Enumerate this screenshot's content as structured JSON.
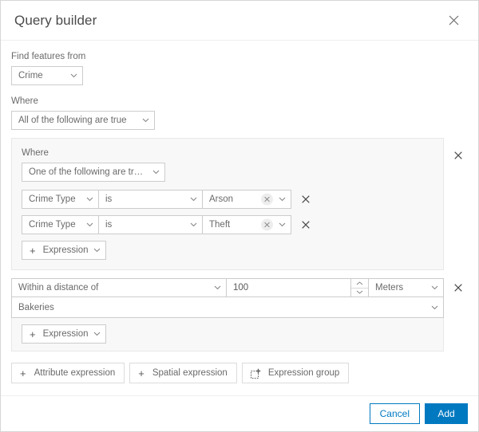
{
  "dialog": {
    "title": "Query builder",
    "close_icon": "close-icon"
  },
  "source": {
    "label": "Find features from",
    "value": "Crime"
  },
  "where": {
    "label": "Where",
    "value": "All of the following are true"
  },
  "group": {
    "label": "Where",
    "value": "One of the following are tr…",
    "remove_icon": "close-icon",
    "expressions": [
      {
        "field": "Crime Type",
        "operator": "is",
        "value": "Arson",
        "clear_icon": "close-icon",
        "remove_icon": "close-icon"
      },
      {
        "field": "Crime Type",
        "operator": "is",
        "value": "Theft",
        "clear_icon": "close-icon",
        "remove_icon": "close-icon"
      }
    ],
    "add_expression": {
      "plus": "+",
      "label": "Expression"
    }
  },
  "spatial": {
    "relationship": "Within a distance of",
    "distance": "100",
    "unit": "Meters",
    "target": "Bakeries",
    "remove_icon": "close-icon",
    "spinner_up_icon": "chevron-up-icon",
    "spinner_down_icon": "chevron-down-icon",
    "add_expression": {
      "plus": "+",
      "label": "Expression"
    }
  },
  "toolbar": {
    "attribute_expression": {
      "plus": "+",
      "label": "Attribute expression"
    },
    "spatial_expression": {
      "plus": "+",
      "label": "Spatial expression"
    },
    "expression_group": {
      "icon": "expression-group-icon",
      "label": "Expression group"
    }
  },
  "footer": {
    "cancel_label": "Cancel",
    "add_label": "Add"
  },
  "colors": {
    "accent": "#0079c1",
    "panel": "#f8f8f8",
    "border": "#cccccc",
    "text": "#6a6a6a"
  }
}
